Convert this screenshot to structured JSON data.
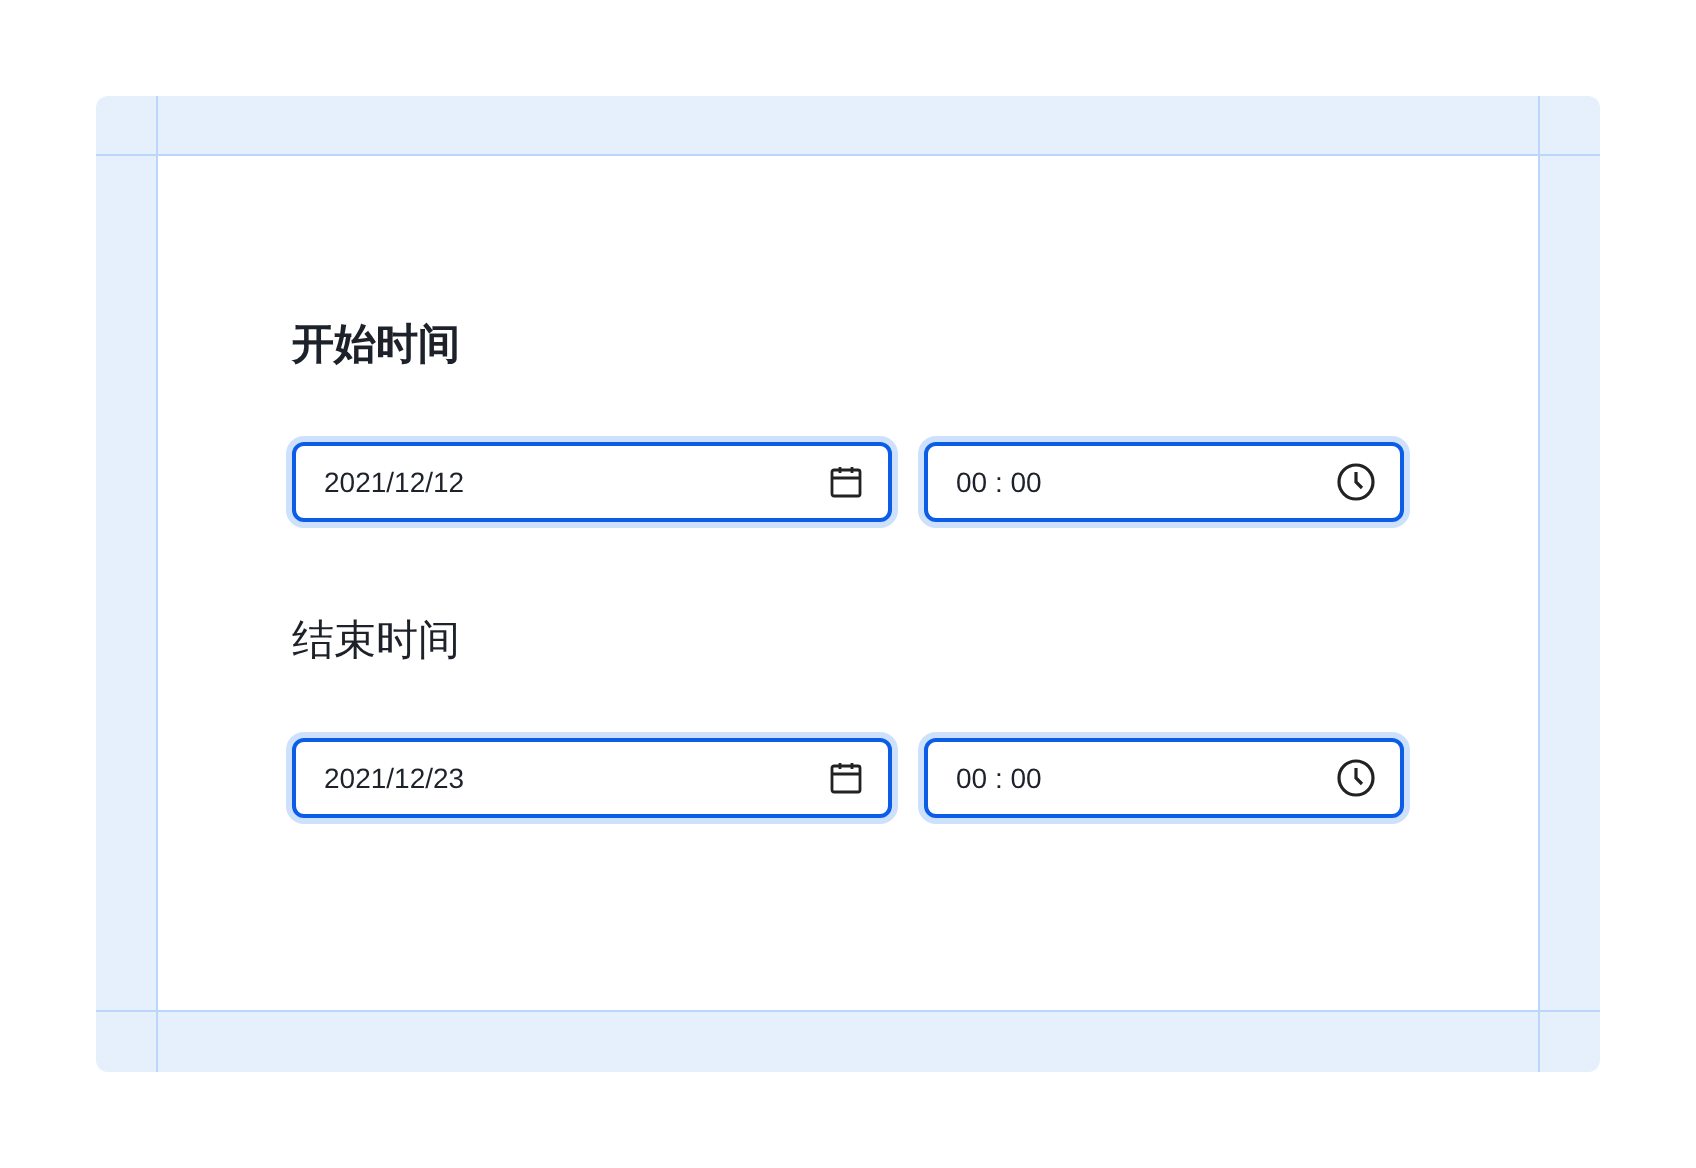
{
  "groups": [
    {
      "label": "开始时间",
      "emphasized": true,
      "date": {
        "value": "2021/12/12",
        "focused": true
      },
      "time": {
        "value": "00 : 00",
        "focused": true
      }
    },
    {
      "label": "结束时间",
      "emphasized": false,
      "date": {
        "value": "2021/12/23",
        "focused": true
      },
      "time": {
        "value": "00 : 00",
        "focused": true
      }
    }
  ]
}
